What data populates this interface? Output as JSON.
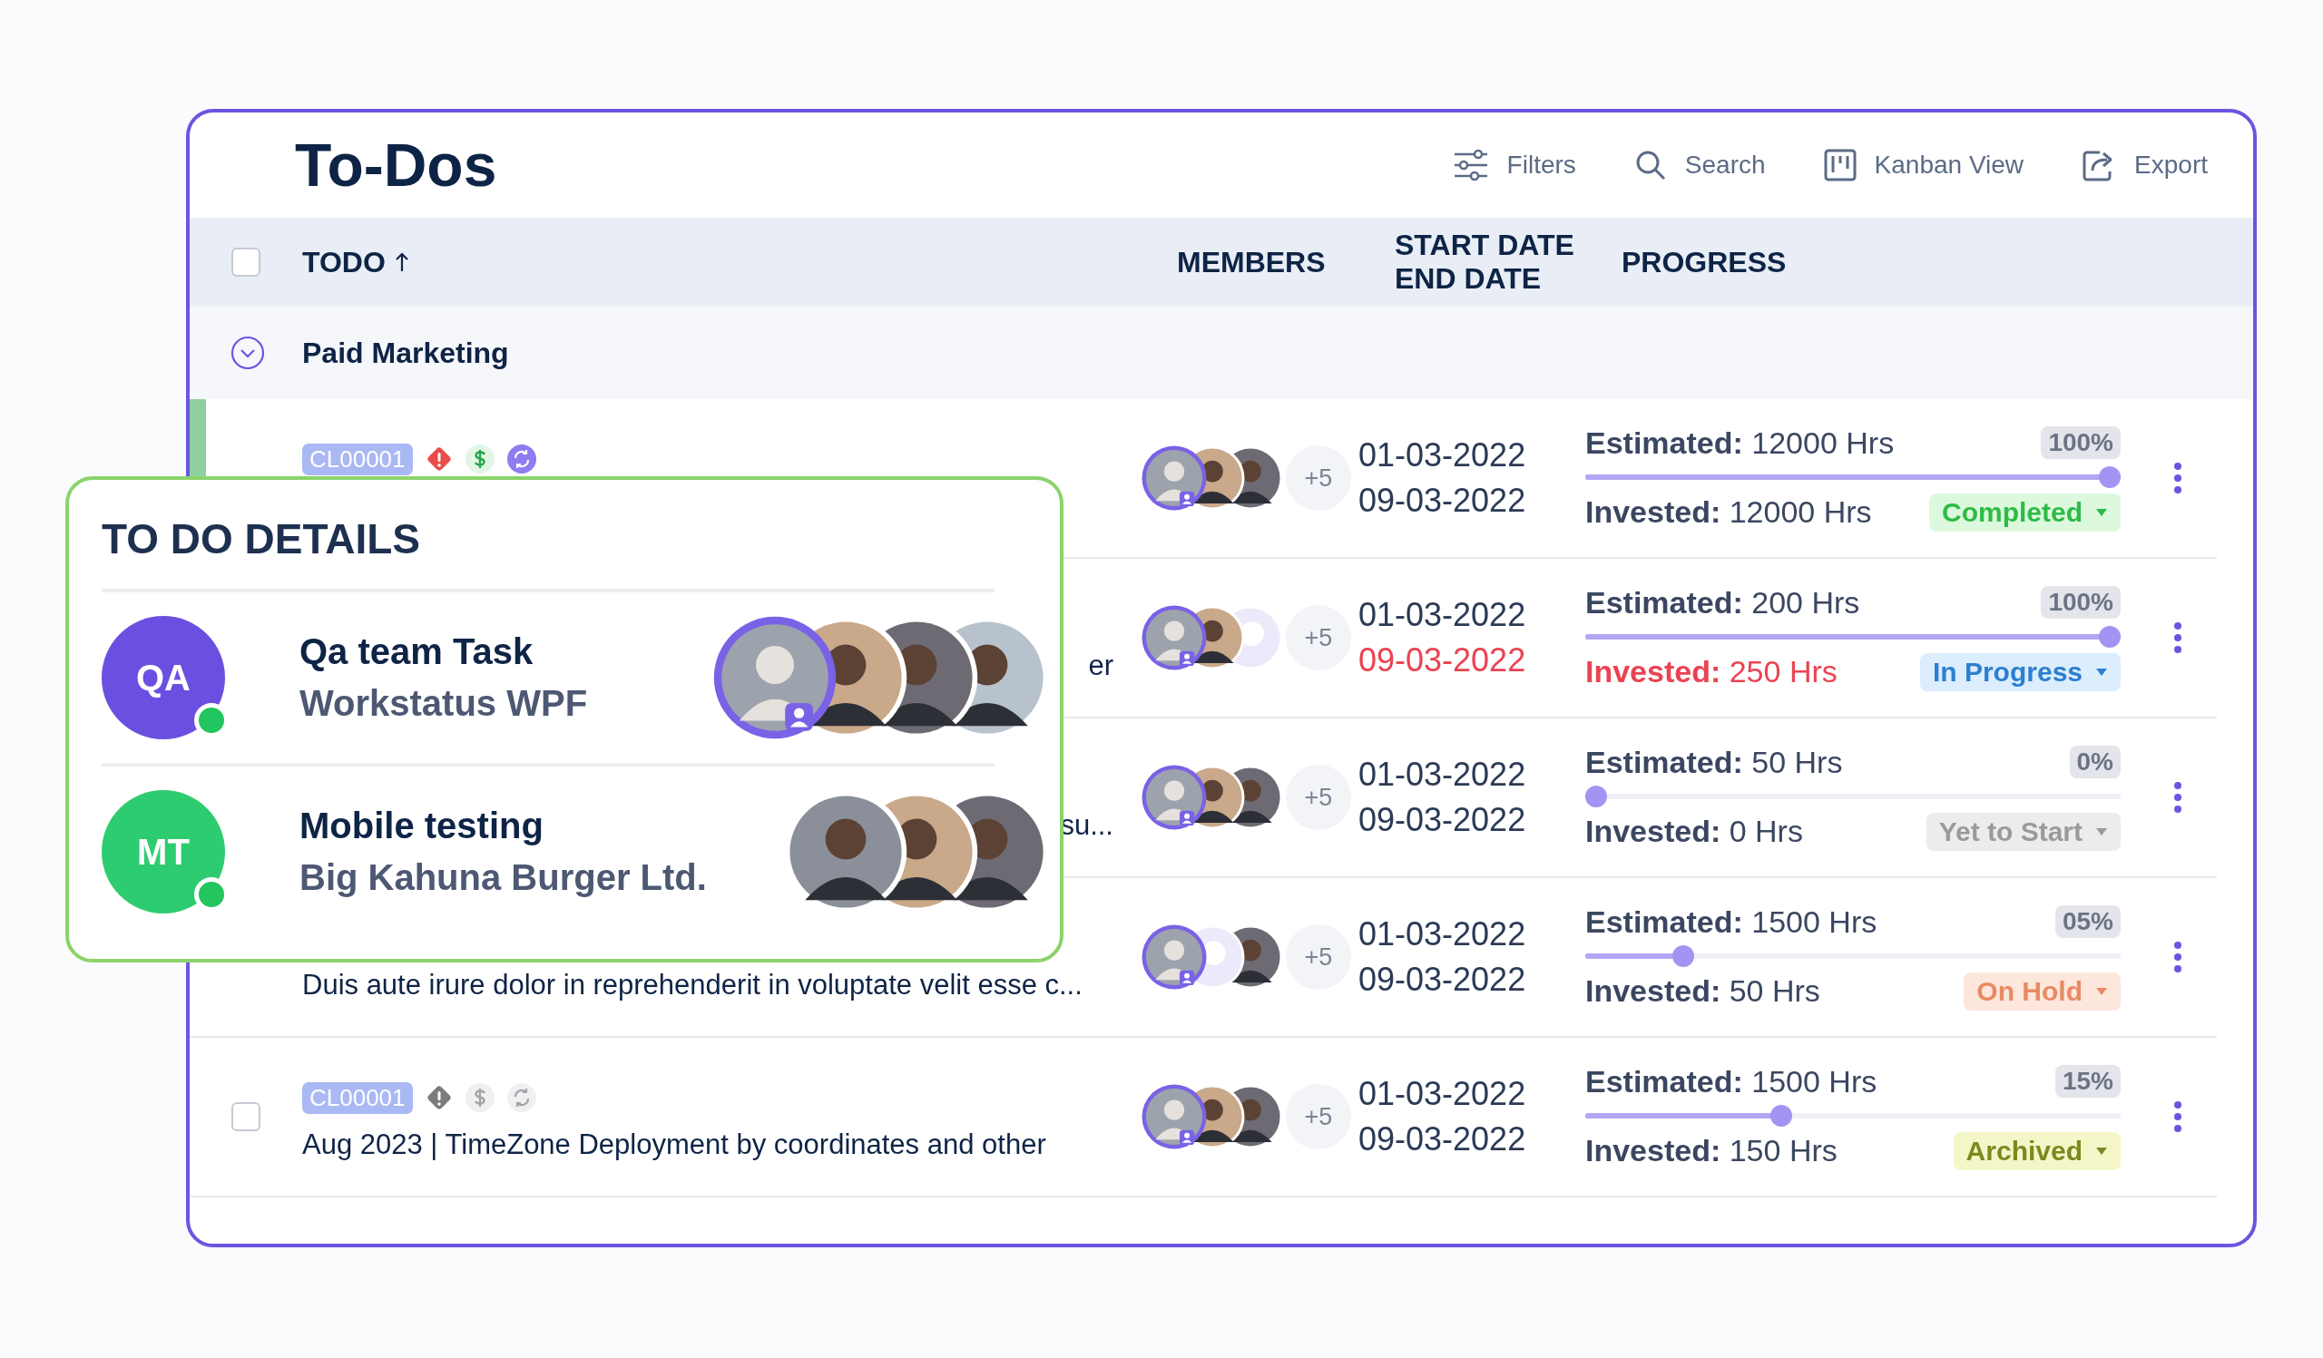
{
  "page": {
    "title": "To-Dos",
    "actions": [
      {
        "kind": "filters",
        "label": "Filters"
      },
      {
        "kind": "search",
        "label": "Search"
      },
      {
        "kind": "kanban",
        "label": "Kanban View"
      },
      {
        "kind": "export",
        "label": "Export"
      }
    ]
  },
  "table": {
    "columns": [
      {
        "label": "TODO",
        "sorted": true
      },
      {
        "label": "MEMBERS"
      },
      {
        "label": "START DATE",
        "label_2": "END DATE"
      },
      {
        "label": "PROGRESS"
      }
    ],
    "select_all": {
      "checked": false
    },
    "group": {
      "label": "Paid Marketing",
      "expanded": true
    },
    "rows": [
      {
        "color": "#8fd19e",
        "tags": {
          "code": "CL00001",
          "active": true
        },
        "avatars": [
          {
            "kind": "owner"
          },
          {
            "kind": "photo"
          },
          {
            "kind": "photo"
          }
        ],
        "more": "+5",
        "start": "01-03-2022",
        "end": "09-03-2022",
        "overdue": false,
        "estimated_label": "Estimated:",
        "estimated": "12000 Hrs",
        "invested_label": "Invested:",
        "invested": "12000 Hrs",
        "percent": "100%",
        "level": 1,
        "status": {
          "kind": "completed",
          "label": "Completed"
        }
      },
      {
        "title_tail": "er",
        "avatars": [
          {
            "kind": "owner"
          },
          {
            "kind": "photo"
          },
          {
            "kind": "placeholder"
          }
        ],
        "more": "+5",
        "start": "01-03-2022",
        "end": "09-03-2022",
        "overdue": true,
        "estimated_label": "Estimated:",
        "estimated": "200 Hrs",
        "invested_label": "Invested:",
        "invested": "250 Hrs",
        "percent": "100%",
        "level": 1,
        "status": {
          "kind": "in_progress",
          "label": "In Progress"
        }
      },
      {
        "title_tail": "su...",
        "avatars": [
          {
            "kind": "owner"
          },
          {
            "kind": "photo"
          },
          {
            "kind": "photo"
          }
        ],
        "more": "+5",
        "start": "01-03-2022",
        "end": "09-03-2022",
        "overdue": false,
        "estimated_label": "Estimated:",
        "estimated": "50 Hrs",
        "invested_label": "Invested:",
        "invested": "0 Hrs",
        "percent": "0%",
        "level": 0,
        "status": {
          "kind": "yet_to_start",
          "label": "Yet to Start"
        }
      },
      {
        "title": "Duis aute irure dolor in reprehenderit in voluptate velit esse c...",
        "avatars": [
          {
            "kind": "owner"
          },
          {
            "kind": "placeholder"
          },
          {
            "kind": "photo"
          }
        ],
        "more": "+5",
        "start": "01-03-2022",
        "end": "09-03-2022",
        "overdue": false,
        "estimated_label": "Estimated:",
        "estimated": "1500 Hrs",
        "invested_label": "Invested:",
        "invested": "50 Hrs",
        "percent": "05%",
        "level": 0.17,
        "status": {
          "kind": "on_hold",
          "label": "On Hold"
        }
      },
      {
        "checked": false,
        "tags": {
          "code": "CL00001",
          "active": false
        },
        "title": "Aug 2023 | TimeZone Deployment by coordinates and other",
        "avatars": [
          {
            "kind": "owner"
          },
          {
            "kind": "photo"
          },
          {
            "kind": "photo"
          }
        ],
        "more": "+5",
        "start": "01-03-2022",
        "end": "09-03-2022",
        "overdue": false,
        "estimated_label": "Estimated:",
        "estimated": "1500 Hrs",
        "invested_label": "Invested:",
        "invested": "150 Hrs",
        "percent": "15%",
        "level": 0.36,
        "status": {
          "kind": "archived",
          "label": "Archived"
        }
      }
    ]
  },
  "details": {
    "title": "TO DO DETAILS",
    "items": [
      {
        "initials": "QA",
        "color": "#6b4fe0",
        "online": true,
        "name": "Qa team Task",
        "project": "Workstatus WPF",
        "avatars": [
          {
            "kind": "owner"
          },
          {
            "kind": "photo"
          },
          {
            "kind": "photo"
          },
          {
            "kind": "photo"
          }
        ]
      },
      {
        "initials": "MT",
        "color": "#2ecc71",
        "online": true,
        "name": "Mobile testing",
        "project": "Big Kahuna Burger Ltd.",
        "avatars": [
          {
            "kind": "photo"
          },
          {
            "kind": "photo"
          },
          {
            "kind": "photo"
          }
        ]
      }
    ]
  }
}
